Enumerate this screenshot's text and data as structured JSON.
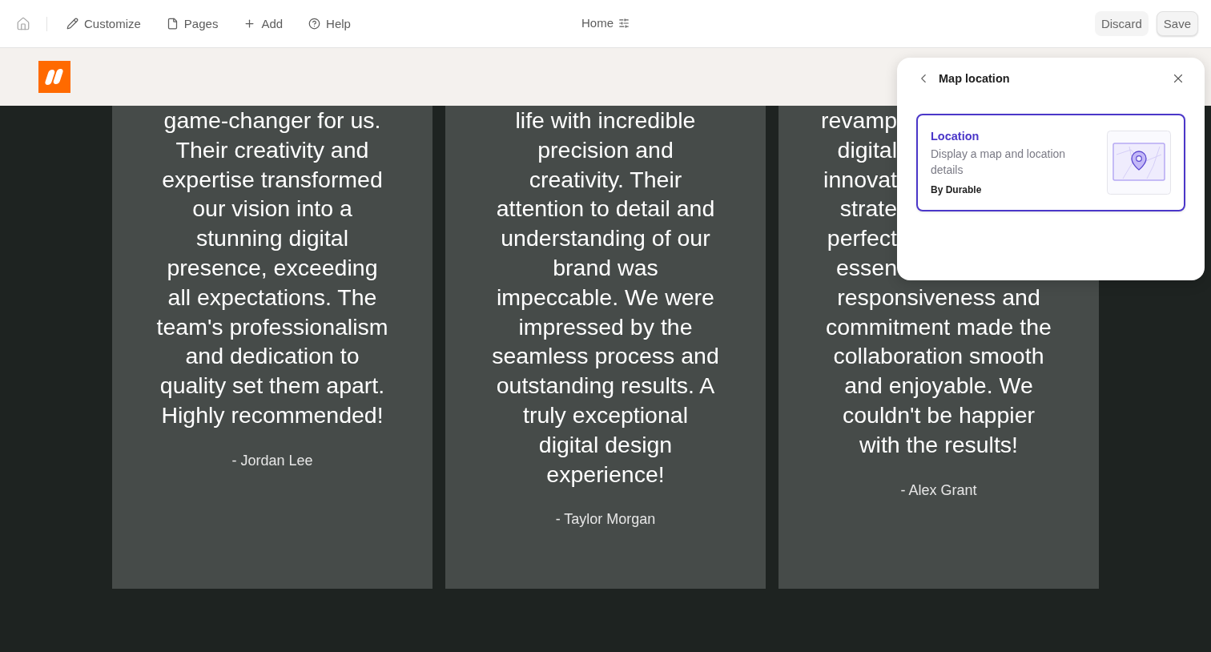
{
  "toolbar": {
    "items": [
      {
        "kind": "edit",
        "label": "Customize"
      },
      {
        "kind": "page",
        "label": "Pages"
      },
      {
        "kind": "add",
        "label": "Add"
      },
      {
        "kind": "help",
        "label": "Help"
      }
    ],
    "page_selector": "Home",
    "discard": "Discard",
    "save": "Save"
  },
  "testimonials": [
    {
      "lines": [
        "game-changer for us.",
        "Their creativity and",
        "expertise transformed",
        "our vision into a",
        "stunning digital",
        "presence, exceeding",
        "all expectations. The",
        "team's professionalism",
        "and dedication to",
        "quality set them apart.",
        "Highly recommended!"
      ],
      "author": "- Jordan Lee"
    },
    {
      "lines": [
        "life with incredible",
        "precision and",
        "creativity. Their",
        "attention to detail and",
        "understanding of our",
        "brand was",
        "impeccable. We were",
        "impressed by the",
        "seamless process and",
        "outstanding results. A",
        "truly exceptional",
        "digital design",
        "experience!"
      ],
      "author": "- Taylor Morgan"
    },
    {
      "clipped_lines": [
        "revamp",
        "digital",
        "innovat",
        "strate",
        "perfect",
        "essen"
      ],
      "lines": [
        "responsiveness and",
        "commitment made the",
        "collaboration smooth",
        "and enjoyable. We",
        "couldn't be happier",
        "with the results!"
      ],
      "author": "- Alex Grant"
    }
  ],
  "panel": {
    "title": "Map location",
    "widget": {
      "title": "Location",
      "description": "Display a map and location details",
      "author": "By Durable",
      "selected": true
    }
  }
}
